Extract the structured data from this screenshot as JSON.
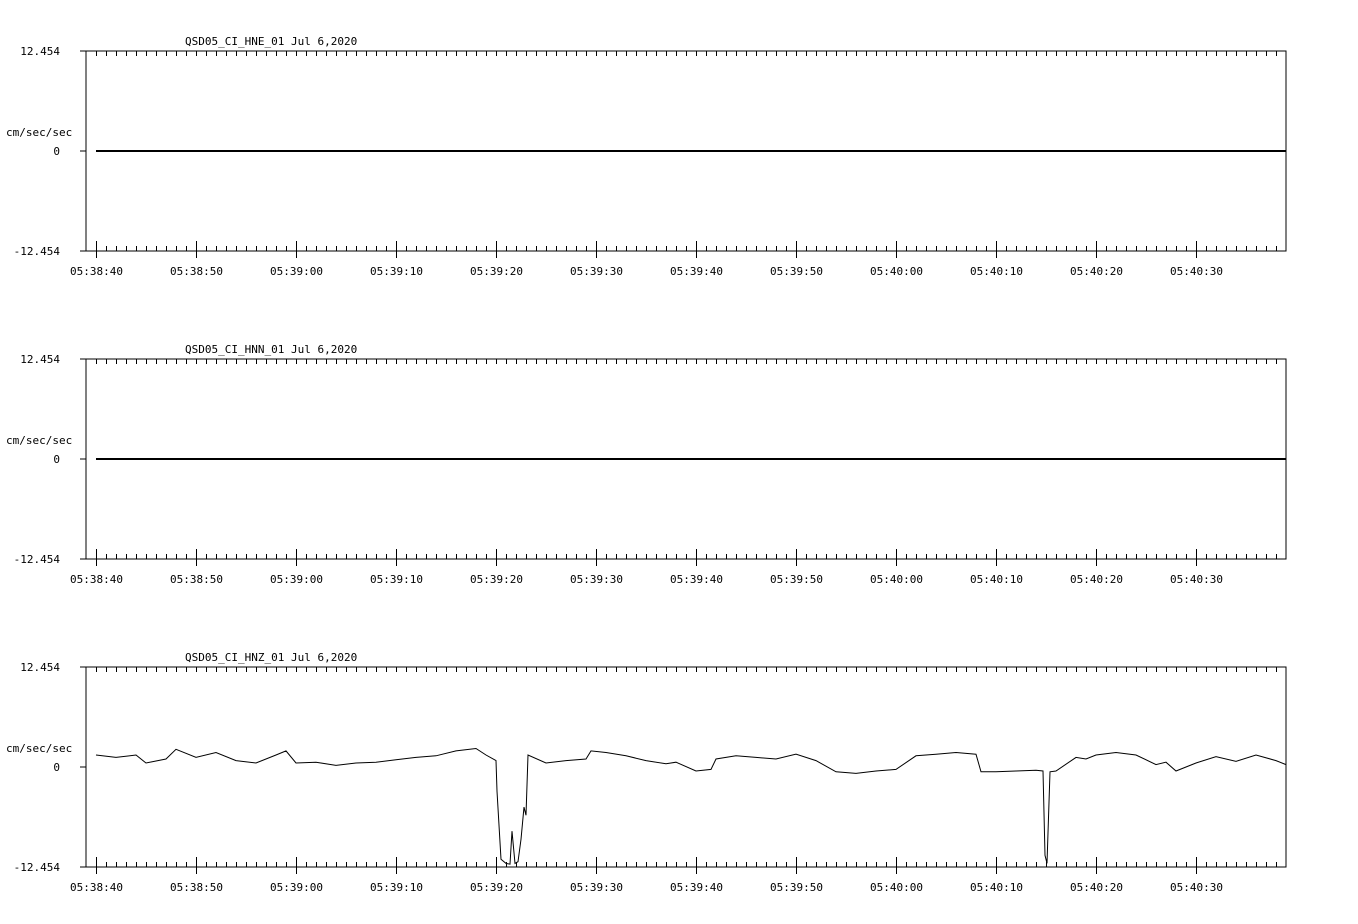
{
  "chart_data": [
    {
      "type": "line",
      "title": "QSD05_CI_HNE_01  Jul 6,2020",
      "ylabel": "cm/sec/sec",
      "ylim": [
        -12.454,
        12.454
      ],
      "y_tick_labels": [
        "12.454",
        "0",
        "-12.454"
      ],
      "x_tick_labels": [
        "05:38:40",
        "05:38:50",
        "05:39:00",
        "05:39:10",
        "05:39:20",
        "05:39:30",
        "05:39:40",
        "05:39:50",
        "05:40:00",
        "05:40:10",
        "05:40:20",
        "05:40:30"
      ],
      "xlim_seconds": [
        -1,
        119
      ],
      "series": [
        {
          "x": [
            0,
            119
          ],
          "y": [
            0,
            0
          ]
        }
      ]
    },
    {
      "type": "line",
      "title": "QSD05_CI_HNN_01  Jul 6,2020",
      "ylabel": "cm/sec/sec",
      "ylim": [
        -12.454,
        12.454
      ],
      "y_tick_labels": [
        "12.454",
        "0",
        "-12.454"
      ],
      "x_tick_labels": [
        "05:38:40",
        "05:38:50",
        "05:39:00",
        "05:39:10",
        "05:39:20",
        "05:39:30",
        "05:39:40",
        "05:39:50",
        "05:40:00",
        "05:40:10",
        "05:40:20",
        "05:40:30"
      ],
      "xlim_seconds": [
        -1,
        119
      ],
      "series": [
        {
          "x": [
            0,
            119
          ],
          "y": [
            0,
            0
          ]
        }
      ]
    },
    {
      "type": "line",
      "title": "QSD05_CI_HNZ_01  Jul 6,2020",
      "ylabel": "cm/sec/sec",
      "ylim": [
        -12.454,
        12.454
      ],
      "y_tick_labels": [
        "12.454",
        "0",
        "-12.454"
      ],
      "x_tick_labels": [
        "05:38:40",
        "05:38:50",
        "05:39:00",
        "05:39:10",
        "05:39:20",
        "05:39:30",
        "05:39:40",
        "05:39:50",
        "05:40:00",
        "05:40:10",
        "05:40:20",
        "05:40:30"
      ],
      "xlim_seconds": [
        -1,
        119
      ],
      "series": [
        {
          "x": [
            0,
            2,
            4,
            5,
            7,
            8,
            10,
            12,
            14,
            16,
            18,
            19,
            20,
            22,
            24,
            26,
            28,
            30,
            32,
            34,
            36,
            38,
            39,
            40,
            40.1,
            40.5,
            41,
            41.4,
            41.6,
            41.9,
            42.2,
            42.5,
            42.8,
            43,
            43.2,
            45,
            47,
            49,
            49.5,
            51,
            53,
            55,
            57,
            58,
            60,
            61.5,
            62,
            64,
            66,
            68,
            70,
            72,
            74,
            76,
            78,
            80,
            82,
            84,
            86,
            88,
            88.5,
            90,
            92,
            94,
            94.7,
            94.9,
            95.1,
            95.4,
            96,
            98,
            99,
            100,
            102,
            104,
            106,
            107,
            108,
            110,
            112,
            114,
            116,
            118,
            119
          ],
          "y": [
            1.5,
            1.2,
            1.5,
            0.5,
            1.0,
            2.2,
            1.2,
            1.8,
            0.8,
            0.5,
            1.5,
            2.0,
            0.5,
            0.6,
            0.2,
            0.5,
            0.6,
            0.9,
            1.2,
            1.4,
            2.0,
            2.3,
            1.5,
            0.8,
            -3,
            -11.5,
            -12.0,
            -12.1,
            -8,
            -12.0,
            -11.8,
            -9,
            -5,
            -6,
            1.5,
            0.5,
            0.8,
            1.0,
            2.0,
            1.8,
            1.4,
            0.8,
            0.4,
            0.6,
            -0.5,
            -0.3,
            1.0,
            1.4,
            1.2,
            1.0,
            1.6,
            0.8,
            -0.6,
            -0.8,
            -0.5,
            -0.3,
            1.4,
            1.6,
            1.8,
            1.6,
            -0.6,
            -0.6,
            -0.5,
            -0.4,
            -0.5,
            -11,
            -12.0,
            -0.6,
            -0.5,
            1.2,
            1.0,
            1.5,
            1.8,
            1.5,
            0.3,
            0.6,
            -0.5,
            0.5,
            1.3,
            0.7,
            1.5,
            0.8,
            0.3
          ]
        }
      ]
    }
  ]
}
